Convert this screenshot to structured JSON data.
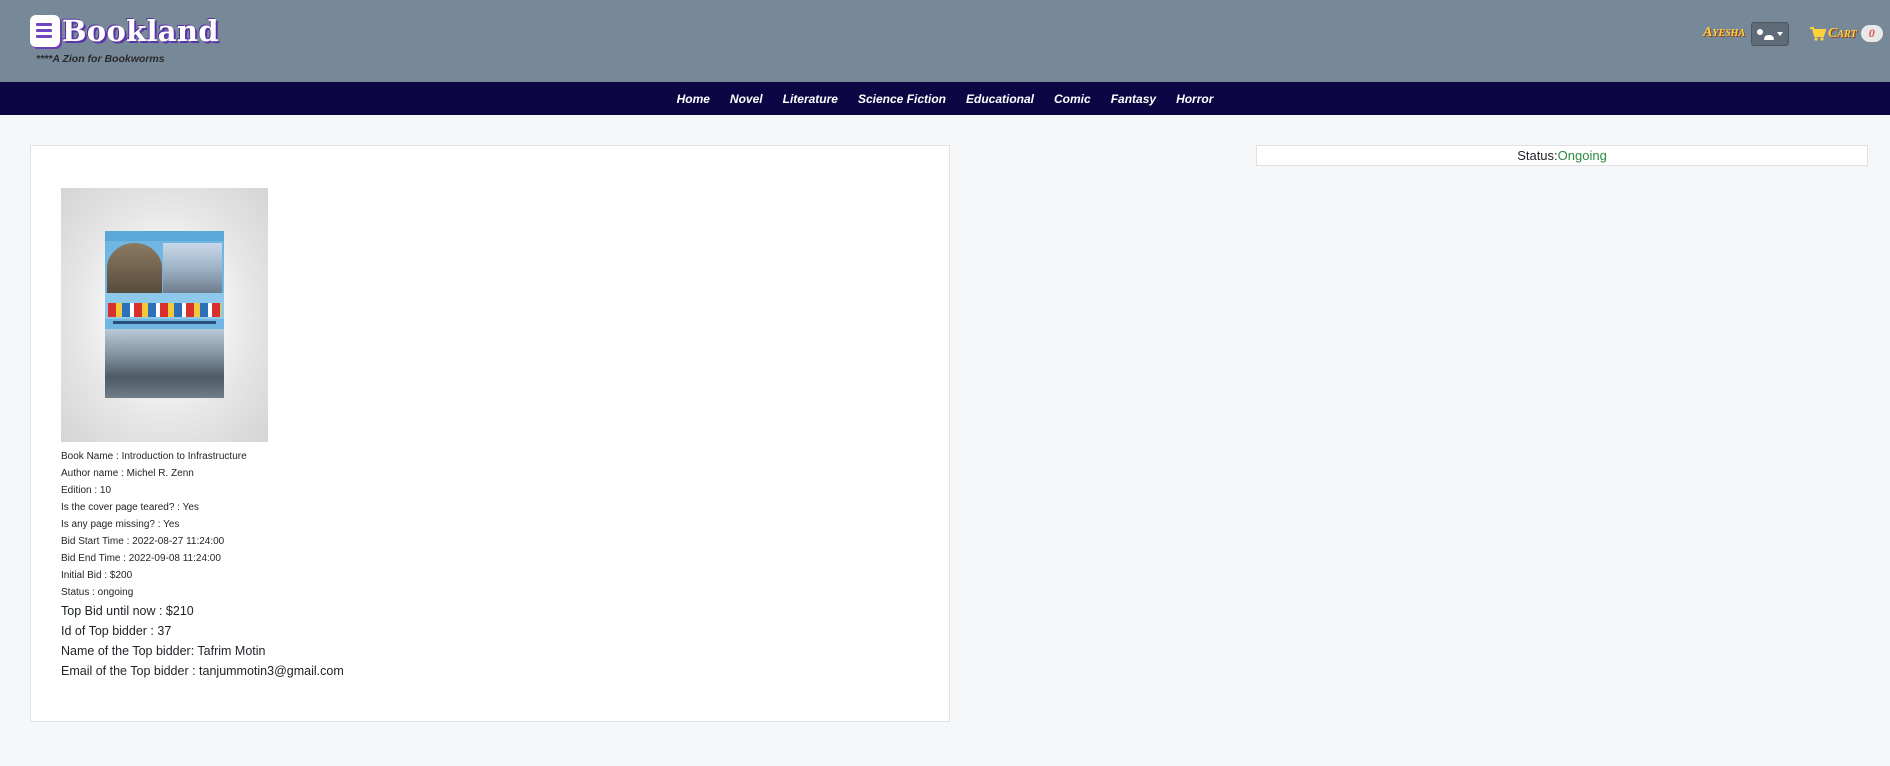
{
  "header": {
    "brand": "Bookland",
    "tagline": "****A Zion for Bookworms",
    "user_name": "Ayesha",
    "cart_label": "Cart",
    "cart_count": "0",
    "accent_color": "#778898",
    "nav_color": "#0c0645"
  },
  "nav": {
    "items": [
      "Home",
      "Novel",
      "Literature",
      "Science Fiction",
      "Educational",
      "Comic",
      "Fantasy",
      "Horror"
    ]
  },
  "book": {
    "cover_icon": "book-cover-image",
    "name_line": "Book Name : Introduction to Infrastructure",
    "author_line": "Author name : Michel R. Zenn",
    "edition_line": "Edition : 10",
    "cover_teared_line": "Is the cover page teared? : Yes",
    "page_missing_line": "Is any page missing? : Yes",
    "bid_start_line": "Bid Start Time : 2022-08-27 11:24:00",
    "bid_end_line": "Bid End Time : 2022-09-08 11:24:00",
    "initial_bid_line": "Initial Bid : $200",
    "status_line": "Status : ongoing",
    "top_bid_line": "Top Bid until now : $210",
    "top_bidder_id_line": "Id of Top bidder : 37",
    "top_bidder_name_line": "Name of the Top bidder: Tafrim Motin",
    "top_bidder_email_line": "Email of the Top bidder : tanjummotin3@gmail.com"
  },
  "status_panel": {
    "label": "Status:",
    "value": "Ongoing",
    "value_color": "#2a8a3c"
  }
}
